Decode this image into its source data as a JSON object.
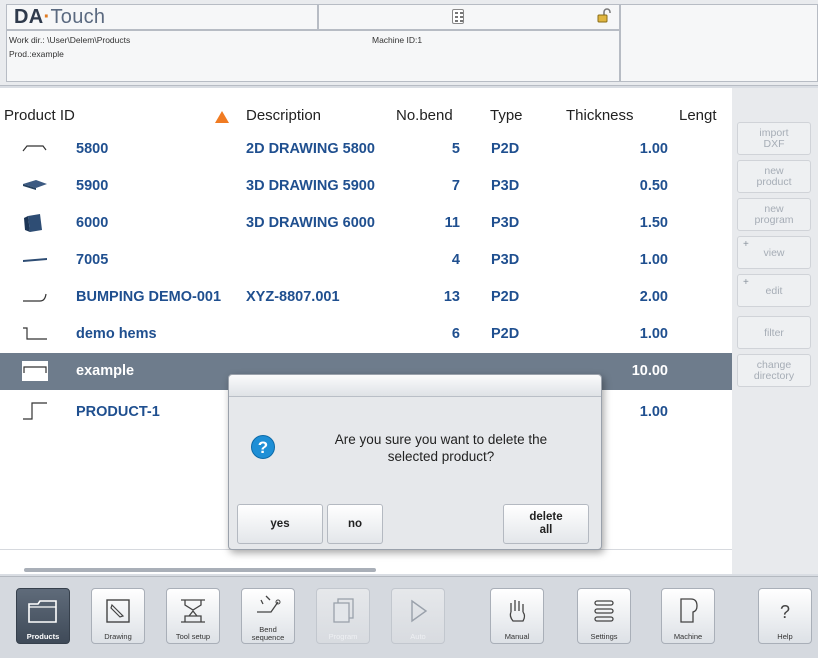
{
  "header": {
    "logo_da": "DA",
    "logo_touch": "Touch",
    "work_dir": "Work dir.: \\User\\Delem\\Products",
    "prod": "Prod.:example",
    "machine_id": "Machine ID:1"
  },
  "table": {
    "columns": [
      "Product ID",
      "Description",
      "No.bend",
      "Type",
      "Thickness",
      "Lengt"
    ],
    "rows": [
      {
        "id": "5800",
        "description": "2D DRAWING 5800",
        "bends": "5",
        "type": "P2D",
        "thickness": "1.00"
      },
      {
        "id": "5900",
        "description": "3D DRAWING 5900",
        "bends": "7",
        "type": "P3D",
        "thickness": "0.50"
      },
      {
        "id": "6000",
        "description": "3D DRAWING 6000",
        "bends": "11",
        "type": "P3D",
        "thickness": "1.50"
      },
      {
        "id": "7005",
        "description": "",
        "bends": "4",
        "type": "P3D",
        "thickness": "1.00"
      },
      {
        "id": "BUMPING DEMO-001",
        "description": "XYZ-8807.001",
        "bends": "13",
        "type": "P2D",
        "thickness": "2.00"
      },
      {
        "id": "demo hems",
        "description": "",
        "bends": "6",
        "type": "P2D",
        "thickness": "1.00"
      },
      {
        "id": "example",
        "description": "",
        "bends": "",
        "type": "",
        "thickness": "10.00"
      },
      {
        "id": "PRODUCT-1",
        "description": "",
        "bends": "",
        "type": "",
        "thickness": "1.00"
      }
    ]
  },
  "side_buttons": [
    {
      "label1": "import",
      "label2": "DXF"
    },
    {
      "label1": "new",
      "label2": "product"
    },
    {
      "label1": "new",
      "label2": "program"
    },
    {
      "label1": "view",
      "label2": ""
    },
    {
      "label1": "edit",
      "label2": ""
    },
    {
      "label1": "filter",
      "label2": ""
    },
    {
      "label1": "change",
      "label2": "directory"
    }
  ],
  "dialog": {
    "message_line1": "Are you sure you want to delete the",
    "message_line2": "selected product?",
    "yes": "yes",
    "no": "no",
    "delete_all_1": "delete",
    "delete_all_2": "all"
  },
  "nav": [
    {
      "label": "Products",
      "icon": "folder-icon",
      "state": "active"
    },
    {
      "label": "Drawing",
      "icon": "pencil-drawing-icon",
      "state": "normal"
    },
    {
      "label": "Tool setup",
      "icon": "tool-setup-icon",
      "state": "normal"
    },
    {
      "label": "Bend sequence",
      "icon": "bend-sequence-icon",
      "state": "normal"
    },
    {
      "label": "Program",
      "icon": "program-pages-icon",
      "state": "disabled"
    },
    {
      "label": "Auto",
      "icon": "play-icon",
      "state": "disabled"
    },
    {
      "label": "Manual",
      "icon": "hand-icon",
      "state": "normal"
    },
    {
      "label": "Settings",
      "icon": "settings-list-icon",
      "state": "normal"
    },
    {
      "label": "Machine",
      "icon": "machine-icon",
      "state": "normal"
    },
    {
      "label": "Help",
      "icon": "help-icon",
      "state": "normal"
    }
  ],
  "colors": {
    "selected_row": "#6e7c8c",
    "link_text": "#1f4f8f",
    "sort_arrow": "#f07b22",
    "question_icon": "#1e8fd6"
  }
}
